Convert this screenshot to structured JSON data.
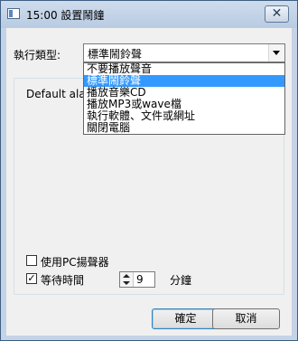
{
  "window": {
    "title": "15:00 設置鬧鐘",
    "close_glyph": "✕"
  },
  "form": {
    "type_label": "執行類型:",
    "selected_value": "標準鬧鈴聲",
    "options": [
      "不要播放聲音",
      "標準鬧鈴聲",
      "播放音樂CD",
      "播放MP3或wave檔",
      "執行軟體、文件或網址",
      "關閉電腦"
    ],
    "highlighted_index": 1,
    "group_text": "Default alarm",
    "use_pc_speaker": {
      "label": "使用PC揚聲器",
      "checked": false
    },
    "wait_time": {
      "label": "等待時間",
      "checked": true,
      "value": "9",
      "unit": "分鐘"
    }
  },
  "buttons": {
    "ok": "確定",
    "cancel": "取消"
  },
  "colors": {
    "selection": "#3399ff",
    "frame": "#c4d3e6"
  }
}
